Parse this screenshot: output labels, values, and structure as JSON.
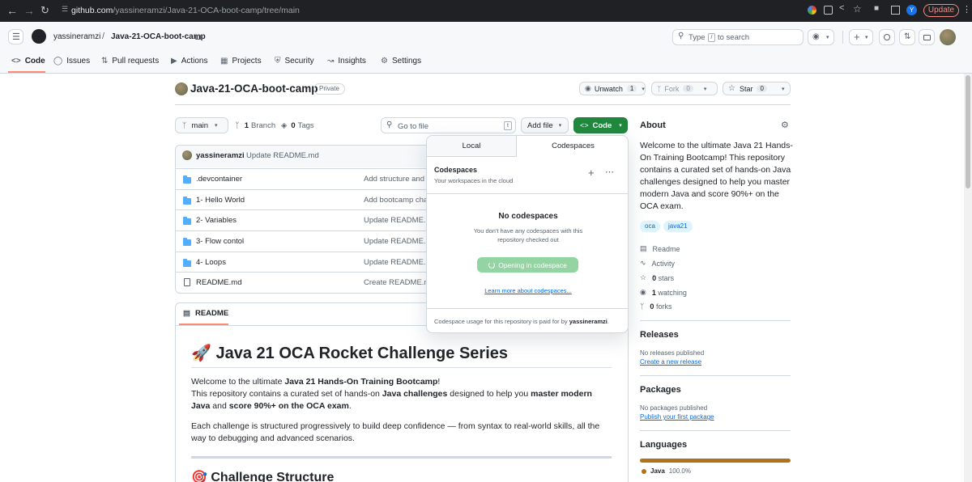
{
  "browser": {
    "url_host": "github.com",
    "url_path": "/yassineramzi/Java-21-OCA-boot-camp/tree/main",
    "profile_initial": "Y",
    "update_label": "Update"
  },
  "header": {
    "owner": "yassineramzi",
    "separator": "/",
    "repo": "Java-21-OCA-boot-camp",
    "search_label": "Type",
    "search_key": "/",
    "search_suffix": "to search"
  },
  "tabs": [
    {
      "label": "Code",
      "icon": "code-icon"
    },
    {
      "label": "Issues",
      "icon": "issue-icon"
    },
    {
      "label": "Pull requests",
      "icon": "pull-request-icon"
    },
    {
      "label": "Actions",
      "icon": "play-icon"
    },
    {
      "label": "Projects",
      "icon": "table-icon"
    },
    {
      "label": "Security",
      "icon": "shield-icon"
    },
    {
      "label": "Insights",
      "icon": "graph-icon"
    },
    {
      "label": "Settings",
      "icon": "gear-icon"
    }
  ],
  "repo": {
    "title": "Java-21-OCA-boot-camp",
    "visibility": "Private",
    "watch_label": "Unwatch",
    "watch_count": "1",
    "fork_label": "Fork",
    "fork_count": "0",
    "star_label": "Star",
    "star_count": "0"
  },
  "toolbar": {
    "branch": "main",
    "branch_count": "1",
    "branch_label": "Branch",
    "tags_count": "0",
    "tags_label": "Tags",
    "goto_placeholder": "Go to file",
    "goto_key": "t",
    "add_file": "Add file",
    "code": "Code"
  },
  "commit": {
    "author": "yassineramzi",
    "message": "Update README.md"
  },
  "files": [
    {
      "name": ".devcontainer",
      "type": "dir",
      "message": "Add structure and"
    },
    {
      "name": "1- Hello World",
      "type": "dir",
      "message": "Add bootcamp cha"
    },
    {
      "name": "2- Variables",
      "type": "dir",
      "message": "Update README.m"
    },
    {
      "name": "3- Flow contol",
      "type": "dir",
      "message": "Update README.m"
    },
    {
      "name": "4- Loops",
      "type": "dir",
      "message": "Update README.m"
    },
    {
      "name": "README.md",
      "type": "file",
      "message": "Create README.m"
    }
  ],
  "readme": {
    "tab": "README",
    "heading_emoji": "🚀",
    "heading": "Java 21 OCA Rocket Challenge Series",
    "p1_a": "Welcome to the ultimate ",
    "p1_b": "Java 21 Hands-On Training Bootcamp",
    "p1_c": "!",
    "p2_a": "This repository contains a curated set of hands-on ",
    "p2_b": "Java challenges",
    "p2_c": " designed to help you ",
    "p2_d": "master modern Java",
    "p2_e": " and ",
    "p2_f": "score 90%+ on the OCA exam",
    "p2_g": ".",
    "p3": "Each challenge is structured progressively to build deep confidence — from syntax to real-world skills, all the way to debugging and advanced scenarios.",
    "h2_emoji": "🎯",
    "h2": "Challenge Structure"
  },
  "popup": {
    "tab_local": "Local",
    "tab_codespaces": "Codespaces",
    "title": "Codespaces",
    "subtitle": "Your workspaces in the cloud",
    "empty_title": "No codespaces",
    "empty_text": "You don't have any codespaces with this repository checked out",
    "open_button": "Opening in codespace",
    "learn_link": "Learn more about codespaces...",
    "footer_a": "Codespace usage for this repository is paid for by ",
    "footer_b": "yassineramzi",
    "footer_c": "."
  },
  "about": {
    "title": "About",
    "description": "Welcome to the ultimate Java 21 Hands-On Training Bootcamp! This repository contains a curated set of hands-on Java challenges designed to help you master modern Java and score 90%+ on the OCA exam.",
    "topics": [
      "oca",
      "java21"
    ],
    "readme": "Readme",
    "activity": "Activity",
    "stars_count": "0",
    "stars_label": "stars",
    "watching_count": "1",
    "watching_label": "watching",
    "forks_count": "0",
    "forks_label": "forks"
  },
  "releases": {
    "title": "Releases",
    "none": "No releases published",
    "link": "Create a new release"
  },
  "packages": {
    "title": "Packages",
    "none": "No packages published",
    "link": "Publish your first package"
  },
  "languages": {
    "title": "Languages",
    "items": [
      {
        "name": "Java",
        "percent": "100.0%",
        "color": "#b07219"
      }
    ]
  }
}
